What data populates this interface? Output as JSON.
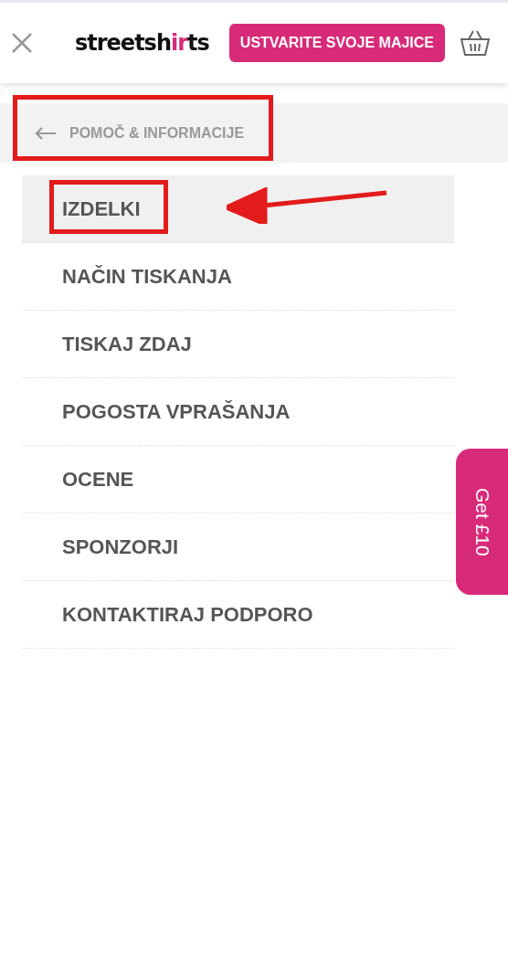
{
  "header": {
    "logo": [
      {
        "text": "streetsh",
        "kind": "plain"
      },
      {
        "text": "ir",
        "kind": "accent"
      },
      {
        "text": "ts",
        "kind": "plain"
      }
    ],
    "cta": "USTVARITE SVOJE MAJICE"
  },
  "back": {
    "label": "POMOČ & INFORMACIJE"
  },
  "menu": [
    {
      "label": "IZDELKI",
      "selected": true
    },
    {
      "label": "NAČIN TISKANJA",
      "selected": false
    },
    {
      "label": "TISKAJ ZDAJ",
      "selected": false
    },
    {
      "label": "POGOSTA VPRAŠANJA",
      "selected": false
    },
    {
      "label": "OCENE",
      "selected": false
    },
    {
      "label": "SPONZORJI",
      "selected": false
    },
    {
      "label": "KONTAKTIRAJ PODPORO",
      "selected": false
    }
  ],
  "side_tab": {
    "label": "Get £10"
  }
}
